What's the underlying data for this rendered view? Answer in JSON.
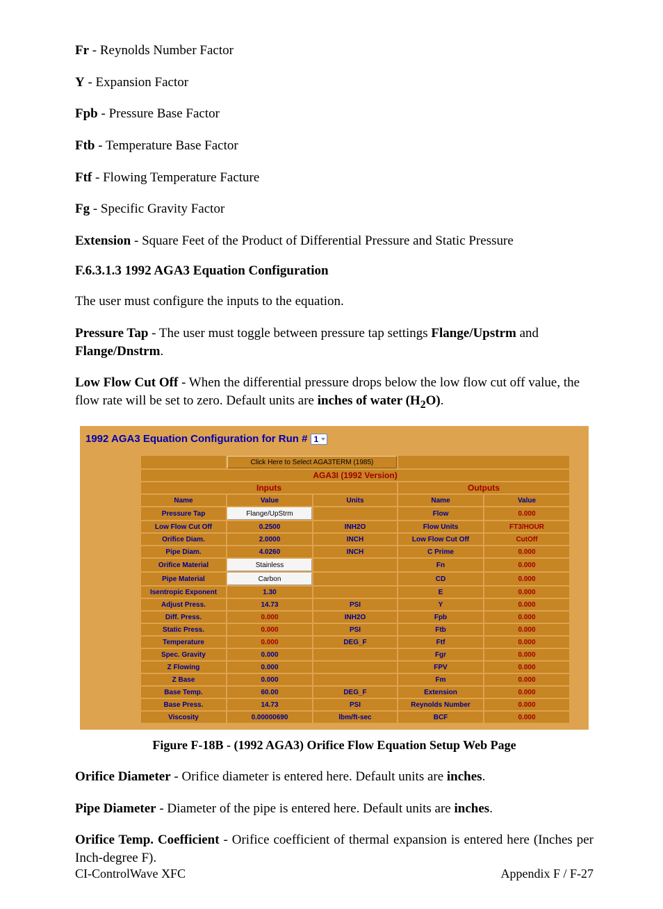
{
  "defs": [
    {
      "term": "Fr",
      "desc": " - Reynolds Number Factor"
    },
    {
      "term": "Y",
      "desc": " - Expansion Factor"
    },
    {
      "term": "Fpb",
      "desc": " - Pressure Base Factor"
    },
    {
      "term": "Ftb",
      "desc": " - Temperature Base Factor"
    },
    {
      "term": "Ftf",
      "desc": " - Flowing Temperature Facture"
    },
    {
      "term": "Fg",
      "desc": " - Specific Gravity Factor"
    },
    {
      "term": "Extension",
      "desc": " - Square Feet of the Product of Differential Pressure and Static Pressure"
    }
  ],
  "section_heading": "F.6.3.1.3   1992 AGA3 Equation Configuration",
  "intro": "The user must configure the inputs to the equation.",
  "pressure_tap_para": {
    "lead": "Pressure Tap",
    "mid1": " - The user must toggle between pressure tap settings ",
    "b1": "Flange/Upstrm",
    "mid2": " and ",
    "b2": "Flange/Dnstrm",
    "end": "."
  },
  "lowflow_para": {
    "lead": "Low Flow Cut Off",
    "mid": " - When the differential pressure drops below the low flow cut off value, the flow rate will be set to zero. Default units are ",
    "b1": "inches of water (H",
    "sub": "2",
    "b2": "O)",
    "end": "."
  },
  "panel": {
    "title_prefix": "1992 AGA3 Equation Configuration for Run # ",
    "run_options": [
      "1"
    ],
    "top_button": "Click Here to Select AGA3TERM (1985)",
    "version_label": "AGA3I (1992 Version)",
    "inputs_label": "Inputs",
    "outputs_label": "Outputs",
    "col_name": "Name",
    "col_value": "Value",
    "col_units": "Units",
    "inputs": [
      {
        "name": "Pressure Tap",
        "value": "Flange/UpStrm",
        "value_type": "edit",
        "units": ""
      },
      {
        "name": "Low Flow Cut Off",
        "value": "0.2500",
        "value_type": "blue",
        "units": "INH2O"
      },
      {
        "name": "Orifice Diam.",
        "value": "2.0000",
        "value_type": "blue",
        "units": "INCH"
      },
      {
        "name": "Pipe Diam.",
        "value": "4.0260",
        "value_type": "blue",
        "units": "INCH"
      },
      {
        "name": "Orifice Material",
        "value": "Stainless",
        "value_type": "edit",
        "units": ""
      },
      {
        "name": "Pipe Material",
        "value": "Carbon",
        "value_type": "edit",
        "units": ""
      },
      {
        "name": "Isentropic Exponent",
        "value": "1.30",
        "value_type": "blue",
        "units": ""
      },
      {
        "name": "Adjust Press.",
        "value": "14.73",
        "value_type": "blue",
        "units": "PSI"
      },
      {
        "name": "Diff. Press.",
        "value": "0.000",
        "value_type": "red",
        "units": "INH2O"
      },
      {
        "name": "Static Press.",
        "value": "0.000",
        "value_type": "red",
        "units": "PSI"
      },
      {
        "name": "Temperature",
        "value": "0.000",
        "value_type": "red",
        "units": "DEG_F"
      },
      {
        "name": "Spec. Gravity",
        "value": "0.000",
        "value_type": "blue",
        "units": ""
      },
      {
        "name": "Z Flowing",
        "value": "0.000",
        "value_type": "blue",
        "units": ""
      },
      {
        "name": "Z Base",
        "value": "0.000",
        "value_type": "blue",
        "units": ""
      },
      {
        "name": "Base Temp.",
        "value": "60.00",
        "value_type": "blue",
        "units": "DEG_F"
      },
      {
        "name": "Base Press.",
        "value": "14.73",
        "value_type": "blue",
        "units": "PSI"
      },
      {
        "name": "Viscosity",
        "value": "0.00000690",
        "value_type": "blue",
        "units": "lbm/ft-sec"
      }
    ],
    "outputs": [
      {
        "name": "Flow",
        "value": "0.000",
        "value_type": "red"
      },
      {
        "name": "Flow Units",
        "value": "FT3/HOUR",
        "value_type": "red"
      },
      {
        "name": "Low Flow Cut Off",
        "value": "CutOff",
        "value_type": "red"
      },
      {
        "name": "C Prime",
        "value": "0.000",
        "value_type": "red"
      },
      {
        "name": "Fn",
        "value": "0.000",
        "value_type": "red"
      },
      {
        "name": "CD",
        "value": "0.000",
        "value_type": "red"
      },
      {
        "name": "E",
        "value": "0.000",
        "value_type": "red"
      },
      {
        "name": "Y",
        "value": "0.000",
        "value_type": "red"
      },
      {
        "name": "Fpb",
        "value": "0.000",
        "value_type": "red"
      },
      {
        "name": "Ftb",
        "value": "0.000",
        "value_type": "red"
      },
      {
        "name": "Ftf",
        "value": "0.000",
        "value_type": "red"
      },
      {
        "name": "Fgr",
        "value": "0.000",
        "value_type": "red"
      },
      {
        "name": "FPV",
        "value": "0.000",
        "value_type": "red"
      },
      {
        "name": "Fm",
        "value": "0.000",
        "value_type": "red"
      },
      {
        "name": "Extension",
        "value": "0.000",
        "value_type": "red"
      },
      {
        "name": "Reynolds Number",
        "value": "0.000",
        "value_type": "red"
      },
      {
        "name": "BCF",
        "value": "0.000",
        "value_type": "red"
      }
    ]
  },
  "figure_caption": "Figure F-18B - (1992 AGA3) Orifice Flow Equation Setup Web Page",
  "post_defs": [
    {
      "term": "Orifice Diameter",
      "desc": " - Orifice diameter is entered here. Default units are ",
      "bold_end": "inches",
      "end": "."
    },
    {
      "term": "Pipe Diameter",
      "desc": " - Diameter of the pipe is entered here. Default units are ",
      "bold_end": "inches",
      "end": "."
    }
  ],
  "orifice_temp_para": {
    "term": "Orifice Temp. Coefficient",
    "desc": " - Orifice coefficient of thermal expansion is entered here (Inches per Inch-degree F)."
  },
  "footer_left": "CI-ControlWave XFC",
  "footer_right": "Appendix F / F-27"
}
